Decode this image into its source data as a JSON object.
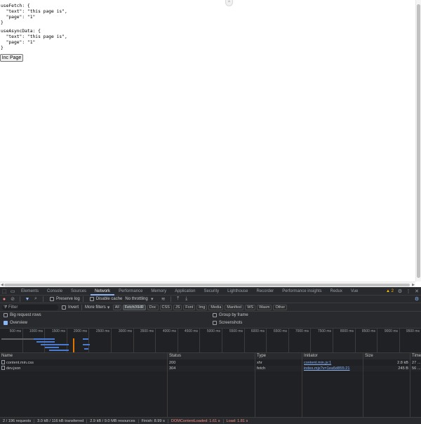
{
  "page": {
    "fetch_block": "useFetch: {\n  \"text\": \"this page is\",\n  \"page\": \"1\"\n}",
    "async_block": "useAsyncData: {\n  \"text\": \"this page is\",\n  \"page\": \"1\"\n}",
    "inc_button_label": "Inc Page"
  },
  "devtools": {
    "tabs": [
      "Elements",
      "Console",
      "Sources",
      "Network",
      "Performance",
      "Memory",
      "Application",
      "Security",
      "Lighthouse",
      "Recorder",
      "Performance insights",
      "Redux",
      "Vue"
    ],
    "active_tab": "Network",
    "warning_count": "2",
    "toolbar": {
      "preserve_log": "Preserve log",
      "disable_cache": "Disable cache",
      "throttling": "No throttling"
    },
    "filter": {
      "placeholder": "Filter",
      "invert": "Invert",
      "more_filters": "More filters",
      "chips": [
        "All",
        "Fetch/XHR",
        "Doc",
        "CSS",
        "JS",
        "Font",
        "Img",
        "Media",
        "Manifest",
        "WS",
        "Wasm",
        "Other"
      ],
      "active_chip": "Fetch/XHR"
    },
    "options": {
      "big_rows": "Big request rows",
      "overview": "Overview",
      "group_by_frame": "Group by frame",
      "screenshots": "Screenshots"
    },
    "timeline_ticks": [
      "500 ms",
      "1000 ms",
      "1500 ms",
      "2000 ms",
      "2500 ms",
      "3000 ms",
      "3500 ms",
      "4000 ms",
      "4500 ms",
      "5000 ms",
      "5500 ms",
      "6000 ms",
      "6500 ms",
      "7000 ms",
      "7500 ms",
      "8000 ms",
      "8500 ms",
      "9000 ms",
      "9500 ms"
    ],
    "columns": [
      "Name",
      "Status",
      "Type",
      "Initiator",
      "Size",
      "Time"
    ],
    "rows": [
      {
        "name": "content.min.css",
        "status": "200",
        "type": "xhr",
        "initiator": "content.min.js:1",
        "size": "2.8 kB",
        "time": "27 ..."
      },
      {
        "name": "dev.json",
        "status": "304",
        "type": "fetch",
        "initiator": "index.mjs?v=1ea5d855:21",
        "size": "245 B",
        "time": "56 ..."
      }
    ],
    "status_bar": {
      "requests": "2 / 196 requests",
      "transferred": "3.0 kB / 116 kB transferred",
      "resources": "2.9 kB / 9.0 MB resources",
      "finish": "Finish: 8.99 s",
      "dcl": "DOMContentLoaded: 1.61 s",
      "load": "Load: 1.81 s"
    }
  }
}
